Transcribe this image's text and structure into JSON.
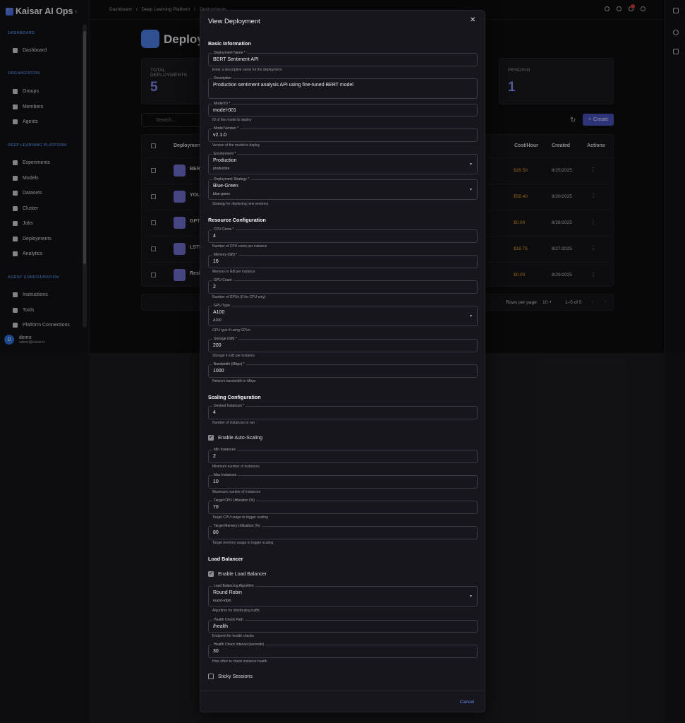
{
  "app": {
    "brand": "Kaisar AI Ops",
    "sections": [
      "DASHBOARD",
      "ORGANIZATION",
      "DEEP LEARNING PLATFORM",
      "AGENT CONFIGURATION"
    ],
    "nav": [
      "Dashboard",
      "Groups",
      "Members",
      "Agents",
      "Experiments",
      "Models",
      "Datasets",
      "Cluster",
      "Jobs",
      "Deployments",
      "Analytics",
      "Instructions",
      "Tools",
      "Platform Connections"
    ],
    "user": {
      "initial": "D",
      "name": "demo",
      "email": "admin@kaisar.io"
    },
    "breadcrumb": [
      "Dashboard",
      "/",
      "Deep Learning Platform",
      "/",
      "Deployments"
    ],
    "page_title": "Deployments",
    "cards": [
      {
        "label": "TOTAL DEPLOYMENTS",
        "value": "5"
      },
      {
        "label": "PENDING",
        "value": "1"
      }
    ],
    "search_placeholder": "Search...",
    "create_label": "Create",
    "table": {
      "headers": [
        "Deployment",
        "Cost/Hour",
        "Created",
        "Actions"
      ],
      "rows": [
        {
          "name": "BERT",
          "cost": "$28.50",
          "created": "8/25/2025"
        },
        {
          "name": "YOLO",
          "cost": "$58.40",
          "created": "8/20/2025"
        },
        {
          "name": "GPT-",
          "cost": "$0.00",
          "created": "8/28/2025"
        },
        {
          "name": "LSTM",
          "cost": "$18.75",
          "created": "8/27/2025"
        },
        {
          "name": "Resh",
          "cost": "$0.00",
          "created": "8/29/2025"
        }
      ]
    },
    "pager": {
      "rows_label": "Rows per page:",
      "rows_value": "10",
      "range": "1–5 of 5"
    }
  },
  "modal": {
    "title": "View Deployment",
    "cancel_label": "Cancel",
    "basic": {
      "heading": "Basic Information",
      "name": {
        "label": "Deployment Name *",
        "value": "BERT Sentiment API",
        "help": "Enter a descriptive name for the deployment"
      },
      "description": {
        "label": "Description",
        "value": "Production sentiment analysis API using fine-tuned BERT model"
      },
      "model_id": {
        "label": "Model ID *",
        "value": "model-001",
        "help": "ID of the model to deploy"
      },
      "model_version": {
        "label": "Model Version *",
        "value": "v2.1.0",
        "help": "Version of the model to deploy"
      },
      "environment": {
        "label": "Environment *",
        "value": "Production",
        "sub": "production"
      },
      "strategy": {
        "label": "Deployment Strategy *",
        "value": "Blue-Green",
        "sub": "blue-green",
        "help": "Strategy for deploying new versions"
      }
    },
    "resource": {
      "heading": "Resource Configuration",
      "cpu": {
        "label": "CPU Cores *",
        "value": "4",
        "help": "Number of CPU cores per instance"
      },
      "memory": {
        "label": "Memory (GB) *",
        "value": "16",
        "help": "Memory in GB per instance"
      },
      "gpu_count": {
        "label": "GPU Count",
        "value": "2",
        "help": "Number of GPUs (0 for CPU-only)"
      },
      "gpu_type": {
        "label": "GPU Type",
        "value": "A100",
        "sub": "A100",
        "help": "GPU type if using GPUs"
      },
      "storage": {
        "label": "Storage (GB) *",
        "value": "200",
        "help": "Storage in GB per instance"
      },
      "bandwidth": {
        "label": "Bandwidth (Mbps) *",
        "value": "1000",
        "help": "Network bandwidth in Mbps"
      }
    },
    "scaling": {
      "heading": "Scaling Configuration",
      "desired": {
        "label": "Desired Instances *",
        "value": "4",
        "help": "Number of instances to run"
      },
      "autoscale_label": "Enable Auto-Scaling",
      "min": {
        "label": "Min Instances",
        "value": "2",
        "help": "Minimum number of instances"
      },
      "max": {
        "label": "Max Instances",
        "value": "10",
        "help": "Maximum number of instances"
      },
      "cpu_target": {
        "label": "Target CPU Utilization (%)",
        "value": "70",
        "help": "Target CPU usage to trigger scaling"
      },
      "mem_target": {
        "label": "Target Memory Utilization (%)",
        "value": "80",
        "help": "Target memory usage to trigger scaling"
      }
    },
    "lb": {
      "heading": "Load Balancer",
      "enable_label": "Enable Load Balancer",
      "algorithm": {
        "label": "Load Balancing Algorithm",
        "value": "Round Robin",
        "sub": "round-robin",
        "help": "Algorithm for distributing traffic"
      },
      "health_path": {
        "label": "Health Check Path",
        "value": "/health",
        "help": "Endpoint for health checks"
      },
      "health_interval": {
        "label": "Health Check Interval (seconds)",
        "value": "30",
        "help": "How often to check instance health"
      },
      "sticky_label": "Sticky Sessions"
    }
  }
}
